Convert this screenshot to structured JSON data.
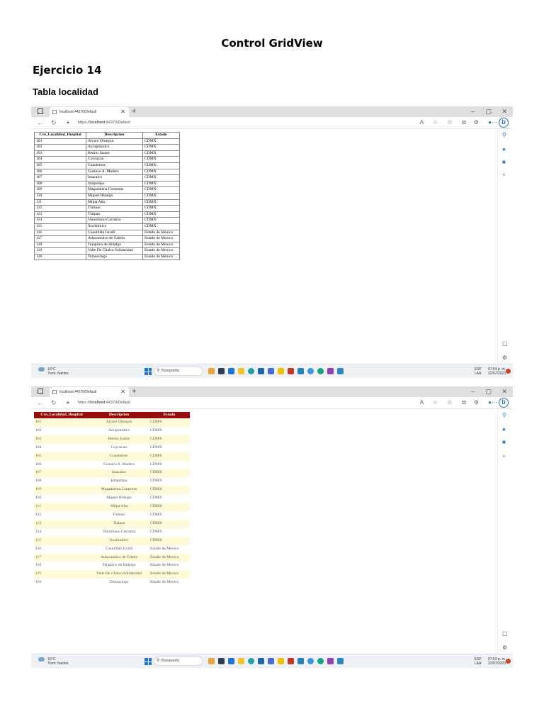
{
  "document": {
    "title": "Control GridView",
    "exercise": "Ejercicio 14",
    "subtitle": "Tabla localidad"
  },
  "browser": {
    "tab_title": "localhost:44370/Default",
    "url_prefix": "https://",
    "url_host": "localhost",
    "url_path": ":44370/Default",
    "new_tab": "+",
    "bing_label": "b"
  },
  "table": {
    "headers": [
      "Cvo_Localidad_Hospital",
      "Descripcion",
      "Estado"
    ],
    "rows": [
      [
        "101",
        "Alvaro Obregon",
        "CDMX"
      ],
      [
        "102",
        "Azcapotzalco",
        "CDMX"
      ],
      [
        "103",
        "Benito Juarez",
        "CDMX"
      ],
      [
        "104",
        "Coyoacan",
        "CDMX"
      ],
      [
        "105",
        "Cuautemoc",
        "CDMX"
      ],
      [
        "106",
        "Gustavo A. Madero",
        "CDMX"
      ],
      [
        "107",
        "Iztacalco",
        "CDMX"
      ],
      [
        "108",
        "Iztapalapa",
        "CDMX"
      ],
      [
        "109",
        "Magadalena Contreras",
        "CDMX"
      ],
      [
        "110",
        "Miguel Hidalgo",
        "CDMX"
      ],
      [
        "111",
        "Milpa Alta",
        "CDMX"
      ],
      [
        "112",
        "Tlahuac",
        "CDMX"
      ],
      [
        "113",
        "Tlalpan",
        "CDMX"
      ],
      [
        "114",
        "Venustiano Carranza",
        "CDMX"
      ],
      [
        "115",
        "Xochimilco",
        "CDMX"
      ],
      [
        "116",
        "Cuautitlán Izcalli",
        "Estado de Mexico"
      ],
      [
        "117",
        "Atlacomulco de Fabela",
        "Estado de Mexico"
      ],
      [
        "118",
        "Tejupilco de Hidalgo",
        "Estado de Mexico"
      ],
      [
        "119",
        "Valle De Chalco Solidaridad",
        "Estado de Mexico"
      ],
      [
        "120",
        "Temascingo",
        "Estado de Mexico"
      ]
    ]
  },
  "taskbar": {
    "weather_temp": "16°C",
    "weather_desc": "Torm. fuertes",
    "search_placeholder": "Búsqueda",
    "lang_top": "ESP",
    "lang_bottom": "LAA",
    "time_1": "07:54 p. m.",
    "time_2": "07:53 p. m.",
    "date": "22/07/2023"
  },
  "colors": {
    "header_bg": "#9b0c0c",
    "alt_row_bg": "#fffbd9",
    "accent": "#2b6fd6"
  }
}
